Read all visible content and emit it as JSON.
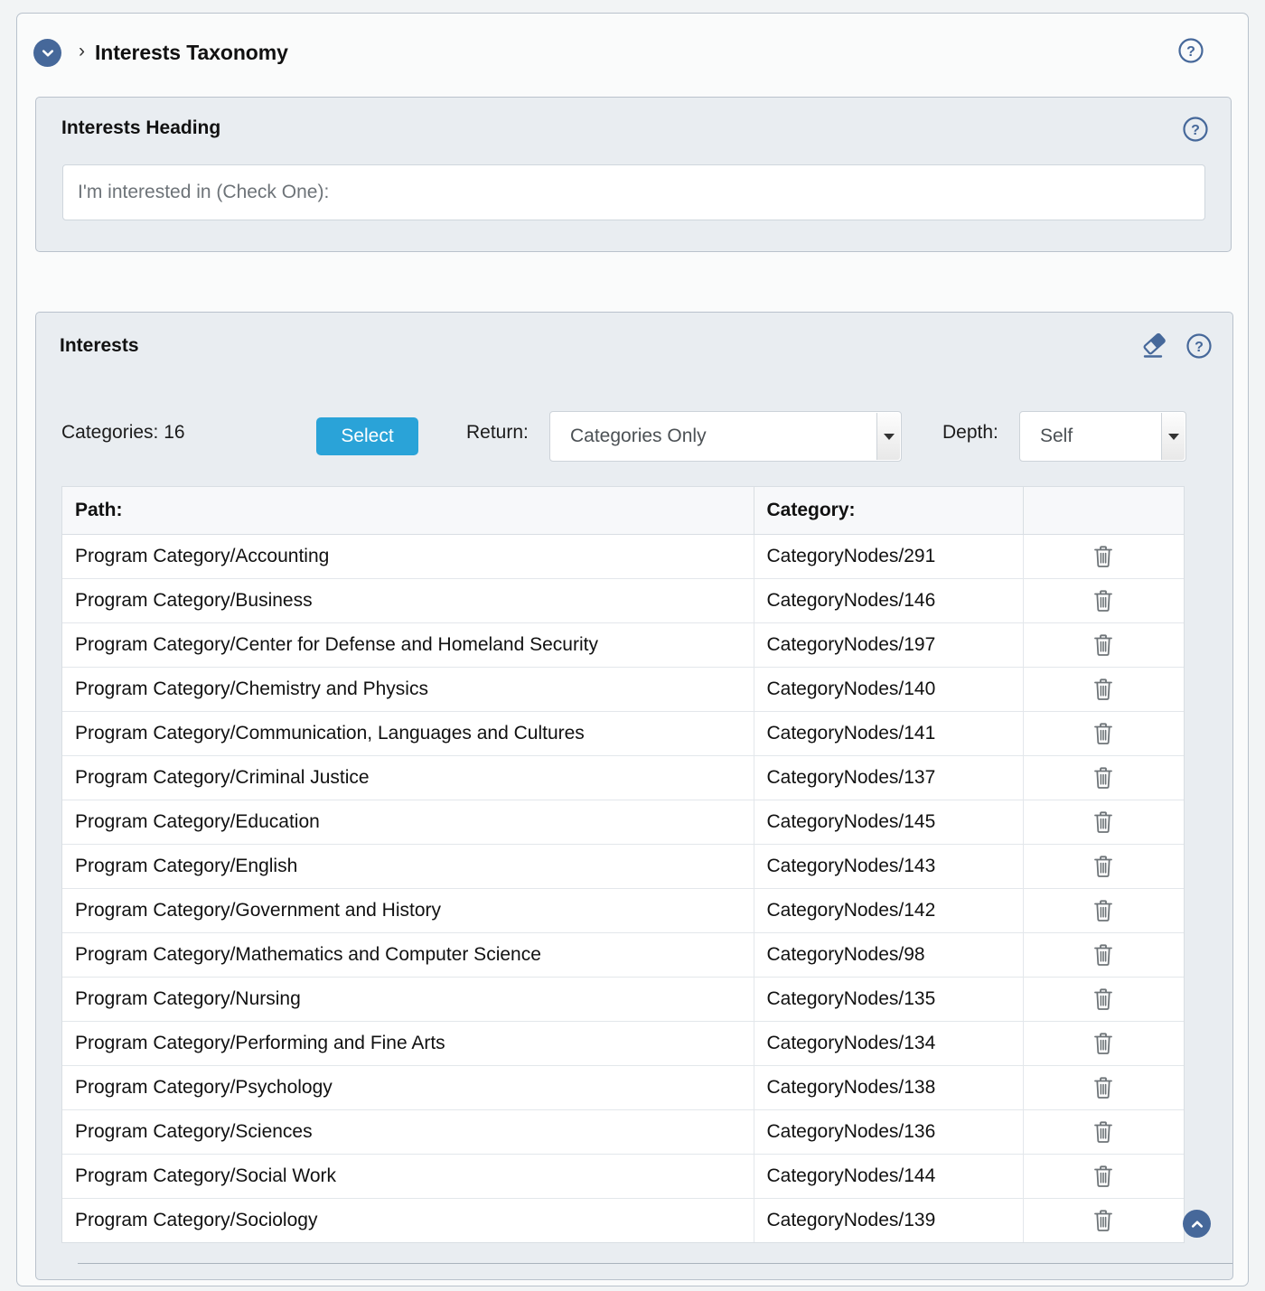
{
  "header": {
    "breadcrumb_separator": "›",
    "title": "Interests Taxonomy",
    "collapse_icon": "chevron-down-circle-icon",
    "help_icon": "help-circle-icon"
  },
  "heading_panel": {
    "title": "Interests Heading",
    "help_icon": "help-circle-icon",
    "input_value": "I'm interested in (Check One):",
    "input_placeholder": "I'm interested in (Check One):"
  },
  "interests_panel": {
    "title": "Interests",
    "eraser_icon": "eraser-icon",
    "help_icon": "help-circle-icon",
    "controls": {
      "count_label": "Categories: 16",
      "select_button": "Select",
      "return_label": "Return:",
      "return_value": "Categories Only",
      "depth_label": "Depth:",
      "depth_value": "Self"
    },
    "table": {
      "columns": [
        "Path:",
        "Category:",
        ""
      ],
      "delete_icon": "trash-icon",
      "rows": [
        {
          "path": "Program Category/Accounting",
          "category": "CategoryNodes/291"
        },
        {
          "path": "Program Category/Business",
          "category": "CategoryNodes/146"
        },
        {
          "path": "Program Category/Center for Defense and Homeland Security",
          "category": "CategoryNodes/197"
        },
        {
          "path": "Program Category/Chemistry and Physics",
          "category": "CategoryNodes/140"
        },
        {
          "path": "Program Category/Communication, Languages and Cultures",
          "category": "CategoryNodes/141"
        },
        {
          "path": "Program Category/Criminal Justice",
          "category": "CategoryNodes/137"
        },
        {
          "path": "Program Category/Education",
          "category": "CategoryNodes/145"
        },
        {
          "path": "Program Category/English",
          "category": "CategoryNodes/143"
        },
        {
          "path": "Program Category/Government and History",
          "category": "CategoryNodes/142"
        },
        {
          "path": "Program Category/Mathematics and Computer Science",
          "category": "CategoryNodes/98"
        },
        {
          "path": "Program Category/Nursing",
          "category": "CategoryNodes/135"
        },
        {
          "path": "Program Category/Performing and Fine Arts",
          "category": "CategoryNodes/134"
        },
        {
          "path": "Program Category/Psychology",
          "category": "CategoryNodes/138"
        },
        {
          "path": "Program Category/Sciences",
          "category": "CategoryNodes/136"
        },
        {
          "path": "Program Category/Social Work",
          "category": "CategoryNodes/144"
        },
        {
          "path": "Program Category/Sociology",
          "category": "CategoryNodes/139"
        }
      ]
    },
    "scroll_top_icon": "chevron-up-circle-icon"
  },
  "colors": {
    "accent_button": "#2aa3d8",
    "icon_blue": "#46689a",
    "panel_bg": "#e9edf1",
    "page_bg": "#f2f4f5"
  }
}
